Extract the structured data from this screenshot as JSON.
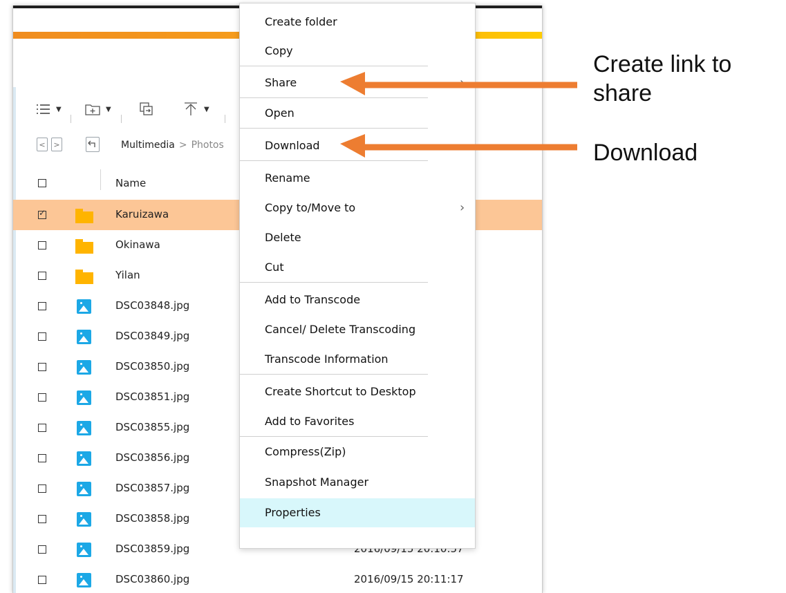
{
  "breadcrumb": {
    "root": "Multimedia",
    "separator": ">",
    "current": "Photos"
  },
  "table": {
    "header_name": "Name",
    "rows": [
      {
        "name": "Karuizawa",
        "type": "folder",
        "checked": true,
        "date": ""
      },
      {
        "name": "Okinawa",
        "type": "folder",
        "checked": false,
        "date": ""
      },
      {
        "name": "Yilan",
        "type": "folder",
        "checked": false,
        "date": ""
      },
      {
        "name": "DSC03848.jpg",
        "type": "image",
        "checked": false,
        "date": ""
      },
      {
        "name": "DSC03849.jpg",
        "type": "image",
        "checked": false,
        "date": ""
      },
      {
        "name": "DSC03850.jpg",
        "type": "image",
        "checked": false,
        "date": ""
      },
      {
        "name": "DSC03851.jpg",
        "type": "image",
        "checked": false,
        "date": ""
      },
      {
        "name": "DSC03855.jpg",
        "type": "image",
        "checked": false,
        "date": ""
      },
      {
        "name": "DSC03856.jpg",
        "type": "image",
        "checked": false,
        "date": ""
      },
      {
        "name": "DSC03857.jpg",
        "type": "image",
        "checked": false,
        "date": ""
      },
      {
        "name": "DSC03858.jpg",
        "type": "image",
        "checked": false,
        "date": ""
      },
      {
        "name": "DSC03859.jpg",
        "type": "image",
        "checked": false,
        "date": "2016/09/15 20:10:57"
      },
      {
        "name": "DSC03860.jpg",
        "type": "image",
        "checked": false,
        "date": "2016/09/15 20:11:17"
      }
    ]
  },
  "context_menu": {
    "items": [
      {
        "label": "Create folder"
      },
      {
        "label": "Copy"
      },
      {
        "label": "Share",
        "submenu": true
      },
      {
        "label": "Open"
      },
      {
        "label": "Download"
      },
      {
        "label": "Rename"
      },
      {
        "label": "Copy to/Move to",
        "submenu": true
      },
      {
        "label": "Delete"
      },
      {
        "label": "Cut"
      },
      {
        "label": "Add to Transcode"
      },
      {
        "label": "Cancel/ Delete Transcoding"
      },
      {
        "label": "Transcode Information"
      },
      {
        "label": "Create Shortcut to Desktop"
      },
      {
        "label": "Add to Favorites"
      },
      {
        "label": "Compress(Zip)"
      },
      {
        "label": "Snapshot Manager"
      },
      {
        "label": "Properties",
        "highlighted": true
      }
    ]
  },
  "annotations": {
    "share_note": "Create link to share",
    "download_note": "Download"
  },
  "colors": {
    "accent": "#f08c1e",
    "selected_row": "#fcc696",
    "menu_highlight": "#d8f7fb",
    "arrow": "#ed7d31",
    "image_icon": "#1ca8e6",
    "folder_icon": "#ffb400"
  },
  "icons": [
    "list-view-icon",
    "new-folder-icon",
    "copy-icon",
    "upload-icon",
    "back-icon",
    "forward-icon",
    "parent-folder-icon",
    "folder-icon",
    "image-file-icon",
    "chevron-right-icon"
  ]
}
